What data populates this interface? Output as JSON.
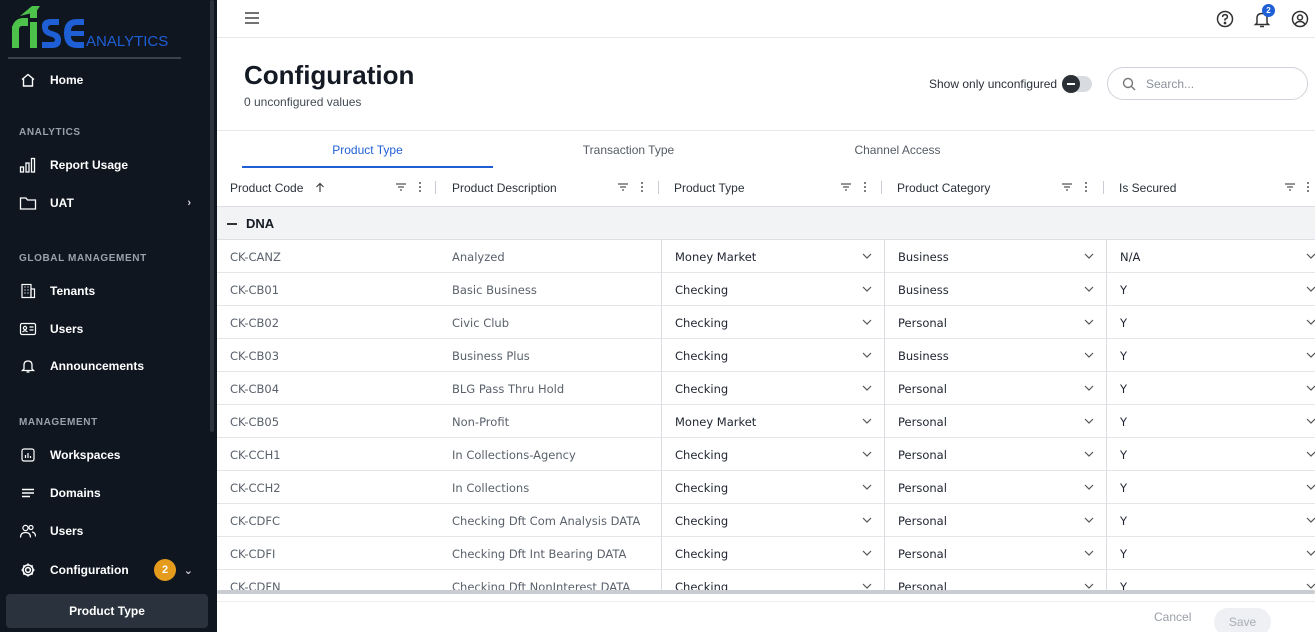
{
  "app": {
    "logo_main": "rise",
    "logo_sub": "ANALYTICS"
  },
  "sidebar": {
    "home": "Home",
    "analytics_title": "ANALYTICS",
    "report_usage": "Report Usage",
    "uat": "UAT",
    "global_title": "GLOBAL MANAGEMENT",
    "tenants": "Tenants",
    "users_global": "Users",
    "announcements": "Announcements",
    "management_title": "MANAGEMENT",
    "workspaces": "Workspaces",
    "domains": "Domains",
    "users": "Users",
    "configuration": "Configuration",
    "configuration_badge": "2",
    "product_type": "Product Type"
  },
  "topbar": {
    "notification_count": "2"
  },
  "header": {
    "title": "Configuration",
    "subtitle": "0 unconfigured values",
    "toggle_label": "Show only unconfigured",
    "search_placeholder": "Search..."
  },
  "tabs": [
    "Product Type",
    "Transaction Type",
    "Channel Access"
  ],
  "columns": [
    "Product Code",
    "Product Description",
    "Product Type",
    "Product Category",
    "Is Secured"
  ],
  "group": "DNA",
  "rows": [
    {
      "code": "CK-CANZ",
      "desc": "Analyzed",
      "type": "Money Market",
      "category": "Business",
      "secured": "N/A"
    },
    {
      "code": "CK-CB01",
      "desc": "Basic Business",
      "type": "Checking",
      "category": "Business",
      "secured": "Y"
    },
    {
      "code": "CK-CB02",
      "desc": "Civic Club",
      "type": "Checking",
      "category": "Personal",
      "secured": "Y"
    },
    {
      "code": "CK-CB03",
      "desc": "Business Plus",
      "type": "Checking",
      "category": "Business",
      "secured": "Y"
    },
    {
      "code": "CK-CB04",
      "desc": "BLG Pass Thru Hold",
      "type": "Checking",
      "category": "Personal",
      "secured": "Y"
    },
    {
      "code": "CK-CB05",
      "desc": "Non-Profit",
      "type": "Money Market",
      "category": "Personal",
      "secured": "Y"
    },
    {
      "code": "CK-CCH1",
      "desc": "In Collections-Agency",
      "type": "Checking",
      "category": "Personal",
      "secured": "Y"
    },
    {
      "code": "CK-CCH2",
      "desc": "In Collections",
      "type": "Checking",
      "category": "Personal",
      "secured": "Y"
    },
    {
      "code": "CK-CDFC",
      "desc": "Checking Dft Com Analysis DATA",
      "type": "Checking",
      "category": "Personal",
      "secured": "Y"
    },
    {
      "code": "CK-CDFI",
      "desc": "Checking Dft Int Bearing DATA",
      "type": "Checking",
      "category": "Personal",
      "secured": "Y"
    },
    {
      "code": "CK-CDFN",
      "desc": "Checking Dft NonInterest DATA",
      "type": "Checking",
      "category": "Personal",
      "secured": "Y"
    }
  ],
  "footer": {
    "cancel": "Cancel",
    "save": "Save"
  }
}
